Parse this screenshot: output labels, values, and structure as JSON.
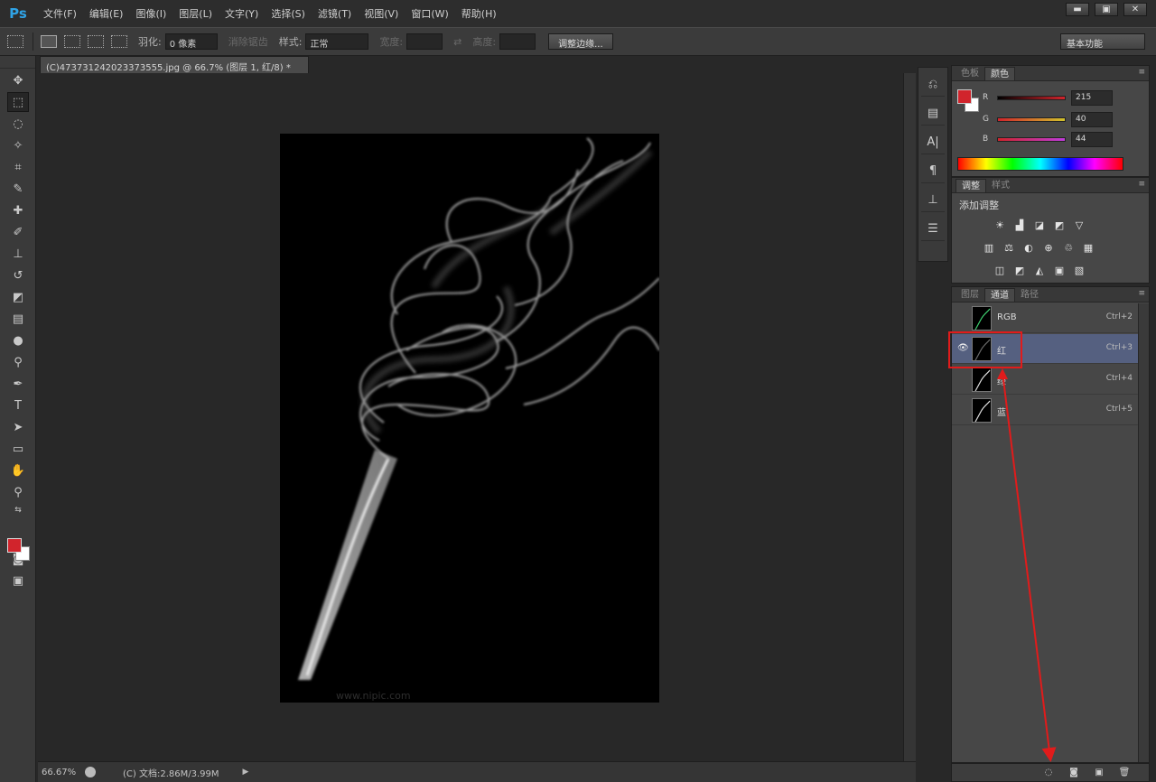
{
  "app": {
    "logo": "Ps"
  },
  "menu": [
    "文件(F)",
    "编辑(E)",
    "图像(I)",
    "图层(L)",
    "文字(Y)",
    "选择(S)",
    "滤镜(T)",
    "视图(V)",
    "窗口(W)",
    "帮助(H)"
  ],
  "window_controls": [
    "▬",
    "▣",
    "✕"
  ],
  "options": {
    "feather_label": "羽化:",
    "feather_value": "0 像素",
    "antialias_label": "消除锯齿",
    "style_label": "样式:",
    "style_value": "正常",
    "width_label": "宽度:",
    "height_label": "高度:",
    "refine_button": "调整边缘...",
    "workspace": "基本功能"
  },
  "document": {
    "tab_title": "(C)473731242023373555.jpg @ 66.7% (图层 1, 红/8) *",
    "watermark": "www.nipic.com",
    "zoom": "66.67%",
    "doc_info": "(C) 文档:2.86M/3.99M"
  },
  "color_panel": {
    "tabs": [
      "色板",
      "颜色"
    ],
    "active_tab": 1,
    "fg_color": "#d1242c",
    "bg_color": "#ffffff",
    "channels": [
      {
        "label": "R",
        "value": "215"
      },
      {
        "label": "G",
        "value": "40"
      },
      {
        "label": "B",
        "value": "44"
      }
    ]
  },
  "adjustments_panel": {
    "tabs": [
      "调整",
      "样式"
    ],
    "active_tab": 0,
    "title": "添加调整",
    "row1": [
      "☀",
      "▟",
      "◪",
      "◩",
      "▽"
    ],
    "row2": [
      "▥",
      "⚖",
      "◐",
      "⊕",
      "♲",
      "▦"
    ],
    "row3": [
      "◫",
      "◩",
      "◭",
      "▣",
      "▧"
    ]
  },
  "channels_panel": {
    "tabs": [
      "图层",
      "通道",
      "路径"
    ],
    "active_tab": 1,
    "rows": [
      {
        "name": "RGB",
        "shortcut": "Ctrl+2",
        "selected": false,
        "visible": false
      },
      {
        "name": "红",
        "shortcut": "Ctrl+3",
        "selected": true,
        "visible": true
      },
      {
        "name": "绿",
        "shortcut": "Ctrl+4",
        "selected": false,
        "visible": false
      },
      {
        "name": "蓝",
        "shortcut": "Ctrl+5",
        "selected": false,
        "visible": false
      }
    ],
    "footer_icons": [
      "load-channel-as-selection-icon",
      "save-selection-as-channel-icon",
      "new-channel-icon",
      "delete-channel-icon"
    ]
  },
  "annotation": {
    "color": "#e11b1b"
  }
}
